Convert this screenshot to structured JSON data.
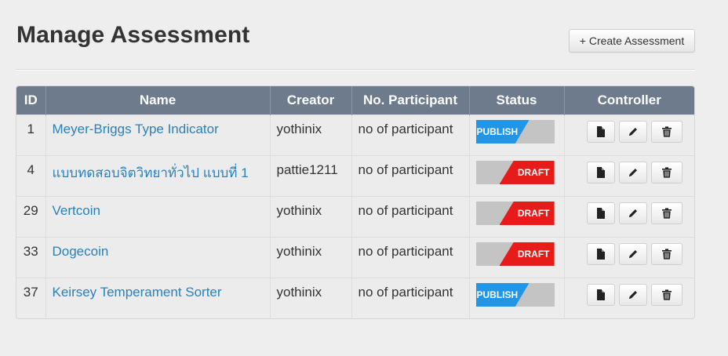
{
  "header": {
    "title": "Manage Assessment",
    "create_button_label": "+ Create Assessment"
  },
  "table": {
    "columns": [
      "ID",
      "Name",
      "Creator",
      "No. Participant",
      "Status",
      "Controller"
    ],
    "rows": [
      {
        "id": "1",
        "name": "Meyer-Briggs Type Indicator",
        "creator": "yothinix",
        "participants": "no of participant",
        "status": "PUBLISH"
      },
      {
        "id": "4",
        "name": "แบบทดสอบจิตวิทยาทั่วไป แบบที่ 1",
        "creator": "pattie1211",
        "participants": "no of participant",
        "status": "DRAFT"
      },
      {
        "id": "29",
        "name": "Vertcoin",
        "creator": "yothinix",
        "participants": "no of participant",
        "status": "DRAFT"
      },
      {
        "id": "33",
        "name": "Dogecoin",
        "creator": "yothinix",
        "participants": "no of participant",
        "status": "DRAFT"
      },
      {
        "id": "37",
        "name": "Keirsey Temperament Sorter",
        "creator": "yothinix",
        "participants": "no of participant",
        "status": "PUBLISH"
      }
    ]
  },
  "controller_icons": [
    "file-icon",
    "pencil-icon",
    "trash-icon"
  ],
  "colors": {
    "header_bg": "#6d7b8c",
    "link": "#2a80b9",
    "publish": "#2196e8",
    "draft": "#e81b1b",
    "toggle_off": "#c4c4c4"
  }
}
